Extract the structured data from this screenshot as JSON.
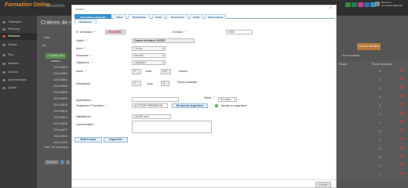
{
  "app": {
    "logo": "Formation Online",
    "section": "Sessions",
    "user_line1": "Bienvenu",
    "user_line2": "Dominique BERNET",
    "accent": "#d24a3e"
  },
  "topbar_icons": [
    {
      "name": "home-icon",
      "color": "#3a8a3a"
    },
    {
      "name": "user-icon",
      "color": "#2d7a5a"
    },
    {
      "name": "mail-icon",
      "color": "#c2408a"
    },
    {
      "name": "help-icon",
      "color": "#3a6aa8"
    },
    {
      "name": "settings-icon",
      "color": "#3a8fc8"
    }
  ],
  "sidebar": {
    "items": [
      {
        "label": "Catalogue"
      },
      {
        "label": "Planning"
      },
      {
        "label": "Sessions"
      },
      {
        "label": "Equipe"
      },
      {
        "label": "Plan"
      },
      {
        "label": "Salariés"
      },
      {
        "label": "Gestion"
      },
      {
        "label": "Administration"
      },
      {
        "label": "Quitter"
      }
    ],
    "active_index": 2
  },
  "background": {
    "criteria_title": "Critères de rec",
    "label_date": "Date",
    "label_du": "Du",
    "add_button": "+ Ajouter une session",
    "session_numbers": [
      "2019-06901",
      "2019-06903",
      "2019-06904",
      "2019-06906",
      "2019-06908",
      "2019-06909",
      "2019-06912",
      "2019-06913",
      "2019-06914",
      "2019-06916",
      "2019-06917",
      "2019-06918",
      "2019-12001"
    ],
    "total": "Total : 61 session(s)",
    "pagination": [
      "Précédent",
      "1",
      "2"
    ],
    "orange_button": "Chercher les filtres",
    "right_label": "Voir les salariés",
    "right_table_headers": [
      "Places",
      "Places restantes"
    ],
    "right_table_values": [
      "0",
      "1",
      "4",
      "4",
      "0",
      "1",
      "1",
      "3",
      "4",
      "3",
      "0",
      "2",
      "1"
    ]
  },
  "modal": {
    "title": "Session",
    "close": "×",
    "tabs_row1": [
      "Informations générales",
      "Dates",
      "Participants",
      "Coûts",
      "Documents",
      "Suivis",
      "Suivis ingéna"
    ],
    "tab_row2": "Évaluation",
    "fields": {
      "session_no_label": "N° de session :",
      "session_no_value": "2019-06902",
      "exercice_label": "Exercice :",
      "exercice_value": "2019",
      "libelle_label": "Libellé :",
      "libelle_value": "Chariot élévateur CACES",
      "axes_label": "Axes :",
      "axes_value": "Combo",
      "domaines_label": "Domaines :",
      "domaines_value": "sécurité",
      "categories_label": "Catégories :",
      "categories_value": "obligatoire",
      "duree_label": "Durée :",
      "duree_value1": "2",
      "jours_label": "Jours",
      "duree_value2": "14",
      "heures_label": "Heures",
      "participants_label": "Participants :",
      "participants_min": "2",
      "pour_label": "pour",
      "participants_max": "6",
      "places_label": "Places restantes",
      "qualification_label": "Qualification :",
      "qualification_value": "",
      "statut_label": "Statut :",
      "statut_value": "En cours",
      "organisme_label": "Organisme / Formateur :",
      "organisme_value": "ALTITUDE FORMATION",
      "recherche_button": "Recherche organisme",
      "ajouter_label": "Ajouter un organisme",
      "habilitations_label": "Habilitations :",
      "habilitations_value": "CACES cat 1",
      "commentaires_label": "Commentaires :"
    },
    "buttons": {
      "update": "Mettre à jour",
      "delete": "Supprimer",
      "close": "Fermer"
    }
  }
}
